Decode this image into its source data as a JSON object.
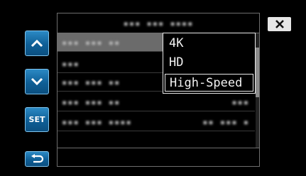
{
  "screen": {
    "title_blurred": "▪▪▪ ▪▪▪ ▪▪▪▪",
    "rows": [
      {
        "label": "▪▪▪ ▪▪▪ ▪▪",
        "value": ""
      },
      {
        "label": "▪▪▪",
        "value": ""
      },
      {
        "label": "▪▪▪ ▪▪▪ ▪▪",
        "value": ""
      },
      {
        "label": "▪▪▪ ▪▪▪ ▪▪",
        "value": "▪▪▪"
      },
      {
        "label": "▪▪▪ ▪▪▪ ▪▪▪▪",
        "value": "▪▪ ▪▪▪ ▪"
      }
    ]
  },
  "buttons": {
    "up_icon": "chevron-up-icon",
    "down_icon": "chevron-down-icon",
    "set_label": "SET",
    "back_icon": "return-icon",
    "close_icon": "close-icon"
  },
  "dropdown": {
    "options": [
      "4K",
      "HD",
      "High-Speed"
    ],
    "highlighted_option": "High-Speed"
  },
  "colors": {
    "button_blue": "#1a70aa",
    "selected_row": "#6b6b6b",
    "popup_border": "#e8e8e8"
  }
}
